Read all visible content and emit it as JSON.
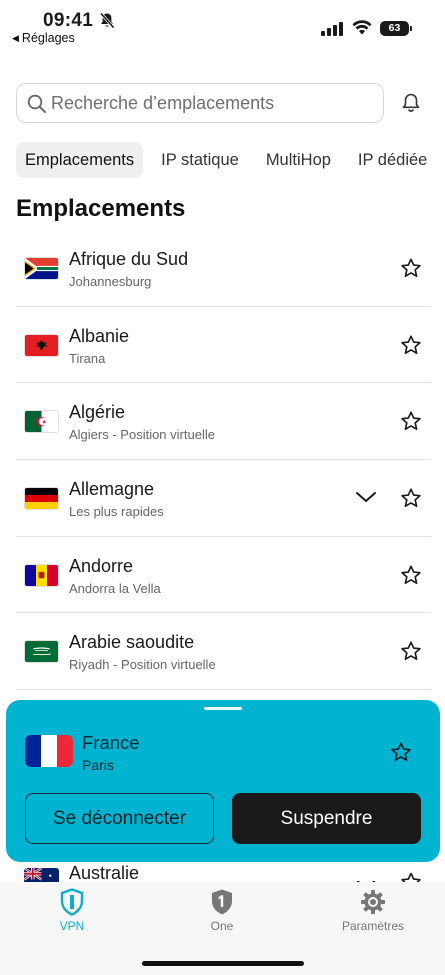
{
  "status_bar": {
    "time": "09:41",
    "back_label": "Réglages",
    "battery": "63"
  },
  "search": {
    "placeholder": "Recherche d’emplacements"
  },
  "tabs": [
    {
      "label": "Emplacements",
      "active": true
    },
    {
      "label": "IP statique",
      "active": false
    },
    {
      "label": "MultiHop",
      "active": false
    },
    {
      "label": "IP dédiée",
      "active": false
    }
  ],
  "section_title": "Emplacements",
  "locations": [
    {
      "country": "Afrique du Sud",
      "city": "Johannesburg",
      "flag": "south-africa",
      "expandable": false
    },
    {
      "country": "Albanie",
      "city": "Tirana",
      "flag": "albania",
      "expandable": false
    },
    {
      "country": "Algérie",
      "city": "Algiers - Position virtuelle",
      "flag": "algeria",
      "expandable": false
    },
    {
      "country": "Allemagne",
      "city": "Les plus rapides",
      "flag": "germany",
      "expandable": true
    },
    {
      "country": "Andorre",
      "city": "Andorra la Vella",
      "flag": "andorra",
      "expandable": false
    },
    {
      "country": "Arabie saoudite",
      "city": "Riyadh - Position virtuelle",
      "flag": "saudi-arabia",
      "expandable": false
    }
  ],
  "partial_location": {
    "country": "Australie",
    "flag": "australia"
  },
  "connection": {
    "country": "France",
    "city": "Paris",
    "disconnect_label": "Se déconnecter",
    "pause_label": "Suspendre",
    "panel_color": "#00b4d1"
  },
  "nav": [
    {
      "label": "VPN",
      "icon": "vpn-shield-icon",
      "active": true
    },
    {
      "label": "One",
      "icon": "one-shield-icon",
      "active": false
    },
    {
      "label": "Paramètres",
      "icon": "gear-icon",
      "active": false
    }
  ],
  "colors": {
    "accent": "#0aaed0",
    "panel": "#00b4d1",
    "button_dark": "#1a1a1a"
  }
}
